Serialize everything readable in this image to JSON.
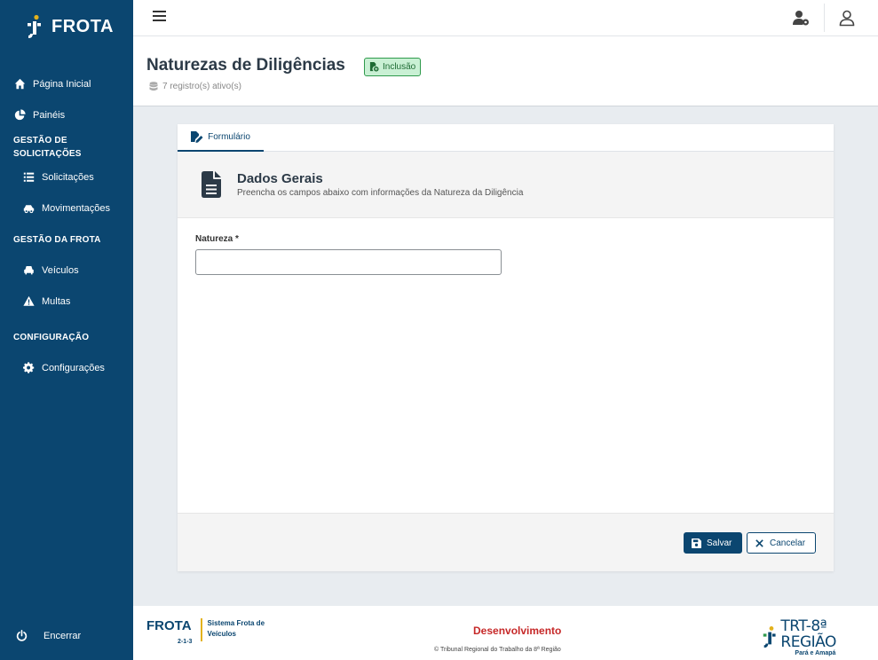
{
  "app": {
    "name": "FROTA"
  },
  "sidebar": {
    "items": [
      {
        "label": "Página Inicial",
        "icon": "home-icon"
      },
      {
        "label": "Painéis",
        "icon": "pie-chart-icon"
      },
      {
        "label": "Solicitações",
        "icon": "list-icon"
      },
      {
        "label": "Movimentações",
        "icon": "car-side-icon"
      },
      {
        "label": "Veículos",
        "icon": "car-icon"
      },
      {
        "label": "Multas",
        "icon": "warning-icon"
      },
      {
        "label": "Configurações",
        "icon": "gear-icon"
      }
    ],
    "sections": [
      "GESTÃO DE SOLICITAÇÕES",
      "GESTÃO DA FROTA",
      "CONFIGURAÇÃO"
    ],
    "logout_label": "Encerrar"
  },
  "header": {
    "title": "Naturezas de Diligências",
    "badge": "Inclusão",
    "records": "7 registro(s) ativo(s)"
  },
  "form": {
    "tab_label": "Formulário",
    "section_title": "Dados Gerais",
    "section_subtitle": "Preencha os campos abaixo com informações da Natureza da Diligência",
    "field_label": "Natureza *",
    "field_value": "",
    "save_label": "Salvar",
    "cancel_label": "Cancelar"
  },
  "footer": {
    "logo": "FROTA",
    "version": "2-1-3",
    "system_name": "Sistema Frota de Veículos",
    "environment": "Desenvolvimento",
    "copyright": "© Tribunal Regional do Trabalho da 8ª Região",
    "org_name": "TRT-8ª REGIÃO",
    "org_sub": "Pará e Amapá"
  },
  "colors": {
    "primary": "#0b4670",
    "accent": "#e3b21d",
    "success": "#2f9a4c",
    "danger": "#c62828"
  }
}
